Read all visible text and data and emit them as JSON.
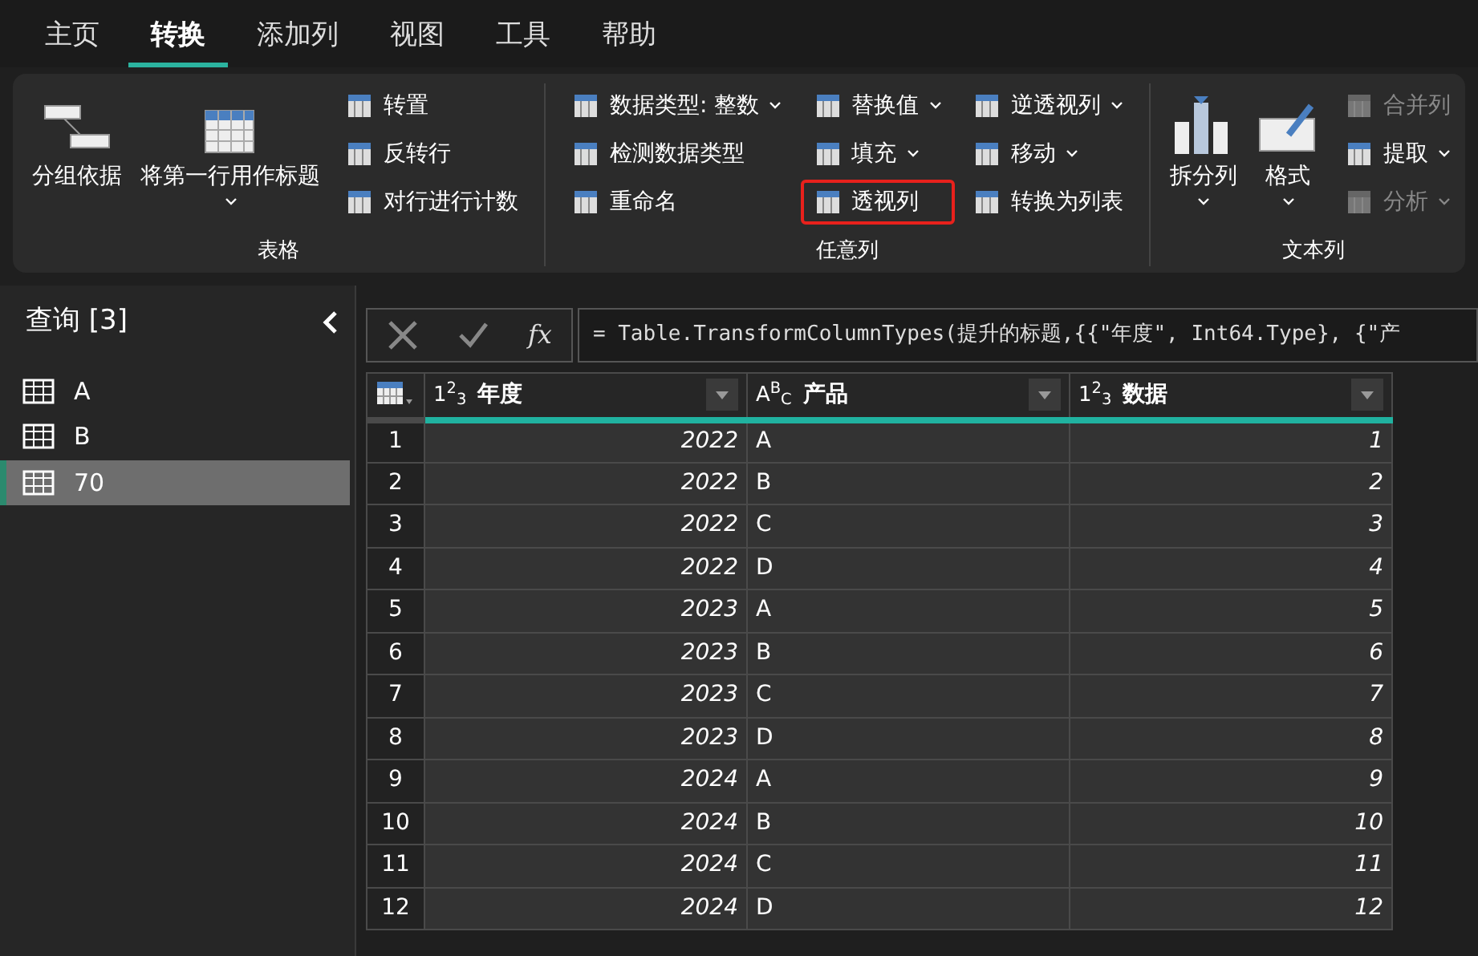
{
  "menu_tabs": [
    {
      "label": "主页",
      "selected": false
    },
    {
      "label": "转换",
      "selected": true
    },
    {
      "label": "添加列",
      "selected": false
    },
    {
      "label": "视图",
      "selected": false
    },
    {
      "label": "工具",
      "selected": false
    },
    {
      "label": "帮助",
      "selected": false
    }
  ],
  "ribbon": {
    "groups": [
      {
        "label": "表格",
        "large": [
          {
            "label": "分组依据",
            "dropdown": false,
            "disabled": false,
            "highlighted": false
          },
          {
            "label": "将第一行用作标题",
            "dropdown": true,
            "disabled": false,
            "highlighted": false
          }
        ],
        "columns": [
          [
            {
              "label": "转置",
              "dropdown": false,
              "disabled": false,
              "highlighted": false
            },
            {
              "label": "反转行",
              "dropdown": false,
              "disabled": false,
              "highlighted": false
            },
            {
              "label": "对行进行计数",
              "dropdown": false,
              "disabled": false,
              "highlighted": false
            }
          ]
        ]
      },
      {
        "label": "任意列",
        "columns": [
          [
            {
              "label": "数据类型: 整数",
              "dropdown": true,
              "disabled": false,
              "highlighted": false
            },
            {
              "label": "检测数据类型",
              "dropdown": false,
              "disabled": false,
              "highlighted": false
            },
            {
              "label": "重命名",
              "dropdown": false,
              "disabled": false,
              "highlighted": false
            }
          ],
          [
            {
              "label": "替换值",
              "dropdown": true,
              "disabled": false,
              "highlighted": false
            },
            {
              "label": "填充",
              "dropdown": true,
              "disabled": false,
              "highlighted": false
            },
            {
              "label": "透视列",
              "dropdown": false,
              "disabled": false,
              "highlighted": true
            }
          ],
          [
            {
              "label": "逆透视列",
              "dropdown": true,
              "disabled": false,
              "highlighted": false
            },
            {
              "label": "移动",
              "dropdown": true,
              "disabled": false,
              "highlighted": false
            },
            {
              "label": "转换为列表",
              "dropdown": false,
              "disabled": false,
              "highlighted": false
            }
          ]
        ]
      },
      {
        "label": "文本列",
        "large": [
          {
            "label": "拆分列",
            "dropdown": true,
            "disabled": false,
            "highlighted": false
          },
          {
            "label": "格式",
            "dropdown": true,
            "disabled": false,
            "highlighted": false
          }
        ],
        "columns": [
          [
            {
              "label": "合并列",
              "dropdown": false,
              "disabled": true,
              "highlighted": false
            },
            {
              "label": "提取",
              "dropdown": true,
              "disabled": false,
              "highlighted": false
            },
            {
              "label": "分析",
              "dropdown": true,
              "disabled": true,
              "highlighted": false
            }
          ]
        ]
      }
    ]
  },
  "queries": {
    "title": "查询 [3]",
    "items": [
      {
        "label": "A",
        "selected": false
      },
      {
        "label": "B",
        "selected": false
      },
      {
        "label": "70",
        "selected": true
      }
    ]
  },
  "formula_bar": {
    "fx": "fx",
    "formula": "= Table.TransformColumnTypes(提升的标题,{{\"年度\", Int64.Type}, {\"产"
  },
  "table": {
    "columns": [
      {
        "name": "年度",
        "type_label": "1$^{2}$$_{3}$",
        "kind": "number"
      },
      {
        "name": "产品",
        "type_label": "A$^{B}$$_{C}$",
        "kind": "text"
      },
      {
        "name": "数据",
        "type_label": "1$^{2}$$_{3}$",
        "kind": "number"
      }
    ],
    "rows": [
      {
        "index": "1",
        "cells": [
          "2022",
          "A",
          "1"
        ]
      },
      {
        "index": "2",
        "cells": [
          "2022",
          "B",
          "2"
        ]
      },
      {
        "index": "3",
        "cells": [
          "2022",
          "C",
          "3"
        ]
      },
      {
        "index": "4",
        "cells": [
          "2022",
          "D",
          "4"
        ]
      },
      {
        "index": "5",
        "cells": [
          "2023",
          "A",
          "5"
        ]
      },
      {
        "index": "6",
        "cells": [
          "2023",
          "B",
          "6"
        ]
      },
      {
        "index": "7",
        "cells": [
          "2023",
          "C",
          "7"
        ]
      },
      {
        "index": "8",
        "cells": [
          "2023",
          "D",
          "8"
        ]
      },
      {
        "index": "9",
        "cells": [
          "2024",
          "A",
          "9"
        ]
      },
      {
        "index": "10",
        "cells": [
          "2024",
          "B",
          "10"
        ]
      },
      {
        "index": "11",
        "cells": [
          "2024",
          "C",
          "11"
        ]
      },
      {
        "index": "12",
        "cells": [
          "2024",
          "D",
          "12"
        ]
      }
    ]
  }
}
